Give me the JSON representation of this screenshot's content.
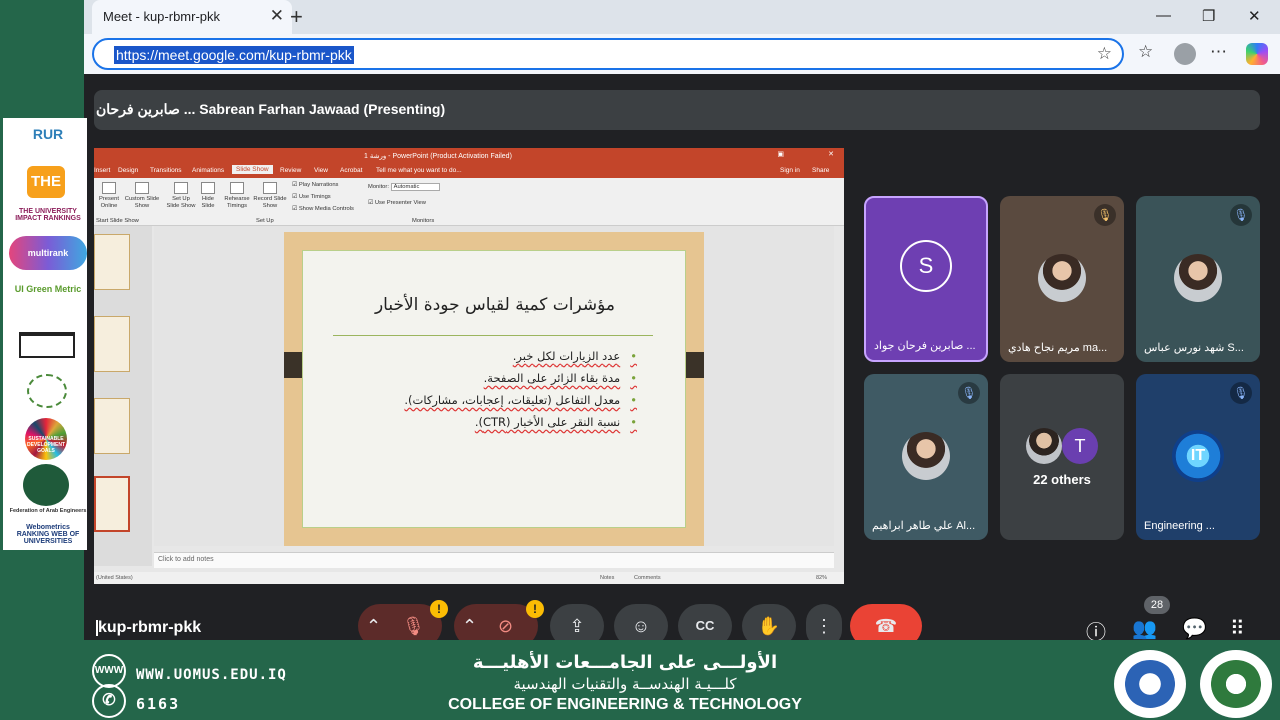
{
  "browser": {
    "tab_title": "Meet - kup-rbmr-pkk",
    "url": "https://meet.google.com/kup-rbmr-pkk",
    "new_tab": "+",
    "close_glyph": "✕"
  },
  "meet": {
    "presenter_label": "صابرين فرحان ... Sabrean Farhan Jawaad (Presenting)",
    "meeting_code": "kup-rbmr-pkk",
    "people_count": "28",
    "tiles": [
      {
        "name": "صابرين فرحان جواد ...",
        "initial": "S"
      },
      {
        "name": "مريم نجاح هادي ma..."
      },
      {
        "name": "شهد نورس عباس S..."
      },
      {
        "name": "علي طاهر ابراهيم Al..."
      },
      {
        "others_label": "22 others",
        "initial": "T"
      },
      {
        "name": "Engineering ...",
        "logo_text": "IT"
      }
    ]
  },
  "ppt": {
    "window_title": "ورشة 1 - PowerPoint (Product Activation Failed)",
    "tabs": [
      "Insert",
      "Design",
      "Transitions",
      "Animations",
      "Slide Show",
      "Review",
      "View",
      "Acrobat"
    ],
    "tell_me": "Tell me what you want to do...",
    "sign_in": "Sign in",
    "share": "Share",
    "ribbon": {
      "present_online": "Present Online",
      "custom_slide_show": "Custom Slide Show",
      "set_up": "Set Up Slide Show",
      "hide_slide": "Hide Slide",
      "rehearse": "Rehearse Timings",
      "record": "Record Slide Show",
      "play_narrations": "Play Narrations",
      "use_timings": "Use Timings",
      "show_media": "Show Media Controls",
      "monitor_label": "Monitor:",
      "monitor_value": "Automatic",
      "presenter_view": "Use Presenter View",
      "group_start": "Start Slide Show",
      "group_setup": "Set Up",
      "group_monitors": "Monitors"
    },
    "slide": {
      "title": "مؤشرات كمية لقياس جودة الأخبار",
      "bullets": [
        "عدد الزيارات لكل خبر.",
        "مدة بقاء الزائر على الصفحة.",
        "معدل التفاعل (تعليقات، إعجابات، مشاركات).",
        "نسبة النقر على الأخبار (CTR)."
      ]
    },
    "notes_placeholder": "Click to add notes",
    "status_language": "(United States)",
    "status_notes": "Notes",
    "status_comments": "Comments",
    "zoom": "82%"
  },
  "left_logos": [
    "RUR",
    "THE",
    "THE UNIVERSITY IMPACT RANKINGS",
    "multirank",
    "UI Green Metric",
    "SUSTAINABLE DEVELOPMENT GOALS",
    "Federation of Arab Engineers",
    "Webometrics RANKING WEB OF UNIVERSITIES"
  ],
  "banner": {
    "website": "WWW.UOMUS.EDU.IQ",
    "phone": "6163",
    "www_badge": "WWW",
    "arabic_line1": "الأولـــى على الجامـــعات الأهليـــة",
    "arabic_line2": "كلـــيـة الهندســة والتقنيات الهندسية",
    "english_line": "COLLEGE OF ENGINEERING & TECHNOLOGY"
  },
  "colors": {
    "meet_bg": "#202124",
    "banner_green": "#24664a",
    "ppt_orange": "#c3452a",
    "hangup_red": "#ea4335",
    "warn_yellow": "#fbbc04"
  }
}
